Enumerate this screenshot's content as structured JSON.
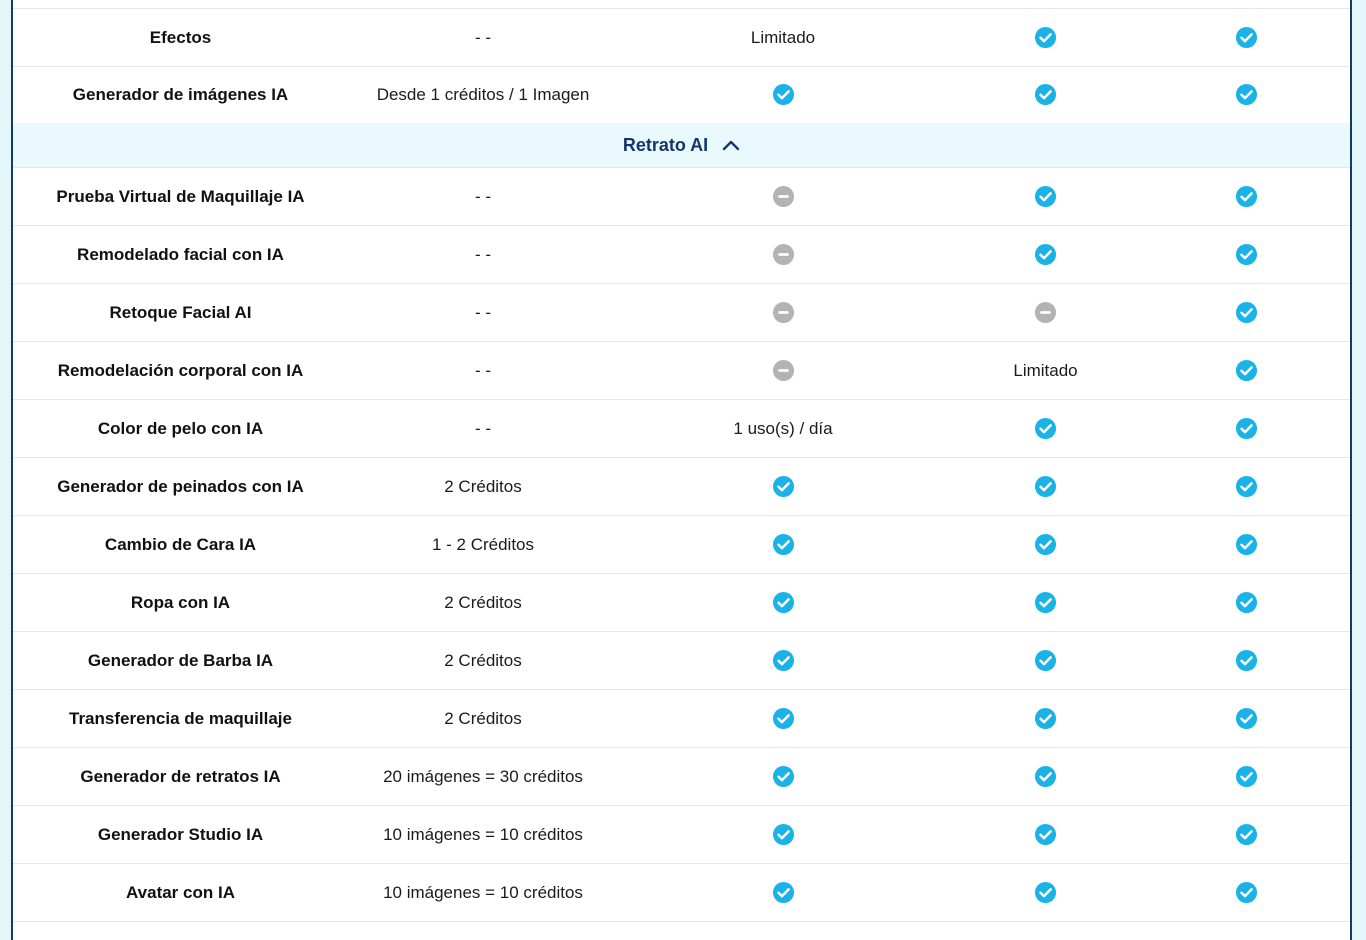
{
  "colors": {
    "accent_check": "#1ab3e8",
    "disabled_dash": "#b3b3b3",
    "section_bg": "#e9f9fd",
    "section_text": "#14376b",
    "frame_border": "#143a6b"
  },
  "top_rows": [
    {
      "feature": "Efectos",
      "basic": "- -",
      "c3": {
        "type": "text",
        "text": "Limitado"
      },
      "c4": {
        "type": "check"
      },
      "c5": {
        "type": "check"
      }
    },
    {
      "feature": "Generador de imágenes IA",
      "basic": "Desde 1 créditos / 1 Imagen",
      "c3": {
        "type": "check"
      },
      "c4": {
        "type": "check"
      },
      "c5": {
        "type": "check"
      }
    }
  ],
  "section": {
    "title": "Retrato AI",
    "icon": "chevron-up-icon"
  },
  "rows": [
    {
      "feature": "Prueba Virtual de Maquillaje IA",
      "basic": "- -",
      "c3": {
        "type": "dash"
      },
      "c4": {
        "type": "check"
      },
      "c5": {
        "type": "check"
      }
    },
    {
      "feature": "Remodelado facial con IA",
      "basic": "- -",
      "c3": {
        "type": "dash"
      },
      "c4": {
        "type": "check"
      },
      "c5": {
        "type": "check"
      }
    },
    {
      "feature": "Retoque Facial AI",
      "basic": "- -",
      "c3": {
        "type": "dash"
      },
      "c4": {
        "type": "dash"
      },
      "c5": {
        "type": "check"
      }
    },
    {
      "feature": "Remodelación corporal con IA",
      "basic": "- -",
      "c3": {
        "type": "dash"
      },
      "c4": {
        "type": "text",
        "text": "Limitado"
      },
      "c5": {
        "type": "check"
      }
    },
    {
      "feature": "Color de pelo con IA",
      "basic": "- -",
      "c3": {
        "type": "text",
        "text": "1 uso(s) / día"
      },
      "c4": {
        "type": "check"
      },
      "c5": {
        "type": "check"
      }
    },
    {
      "feature": "Generador de peinados con IA",
      "basic": "2 Créditos",
      "c3": {
        "type": "check"
      },
      "c4": {
        "type": "check"
      },
      "c5": {
        "type": "check"
      }
    },
    {
      "feature": "Cambio de Cara IA",
      "basic": "1 - 2 Créditos",
      "c3": {
        "type": "check"
      },
      "c4": {
        "type": "check"
      },
      "c5": {
        "type": "check"
      }
    },
    {
      "feature": "Ropa con IA",
      "basic": "2 Créditos",
      "c3": {
        "type": "check"
      },
      "c4": {
        "type": "check"
      },
      "c5": {
        "type": "check"
      }
    },
    {
      "feature": "Generador de Barba IA",
      "basic": "2 Créditos",
      "c3": {
        "type": "check"
      },
      "c4": {
        "type": "check"
      },
      "c5": {
        "type": "check"
      }
    },
    {
      "feature": "Transferencia de maquillaje",
      "basic": "2 Créditos",
      "c3": {
        "type": "check"
      },
      "c4": {
        "type": "check"
      },
      "c5": {
        "type": "check"
      }
    },
    {
      "feature": "Generador de retratos IA",
      "basic": "20 imágenes = 30 créditos",
      "c3": {
        "type": "check"
      },
      "c4": {
        "type": "check"
      },
      "c5": {
        "type": "check"
      }
    },
    {
      "feature": "Generador Studio IA",
      "basic": "10 imágenes = 10 créditos",
      "c3": {
        "type": "check"
      },
      "c4": {
        "type": "check"
      },
      "c5": {
        "type": "check"
      }
    },
    {
      "feature": "Avatar con IA",
      "basic": "10 imágenes = 10 créditos",
      "c3": {
        "type": "check"
      },
      "c4": {
        "type": "check"
      },
      "c5": {
        "type": "check"
      }
    }
  ]
}
